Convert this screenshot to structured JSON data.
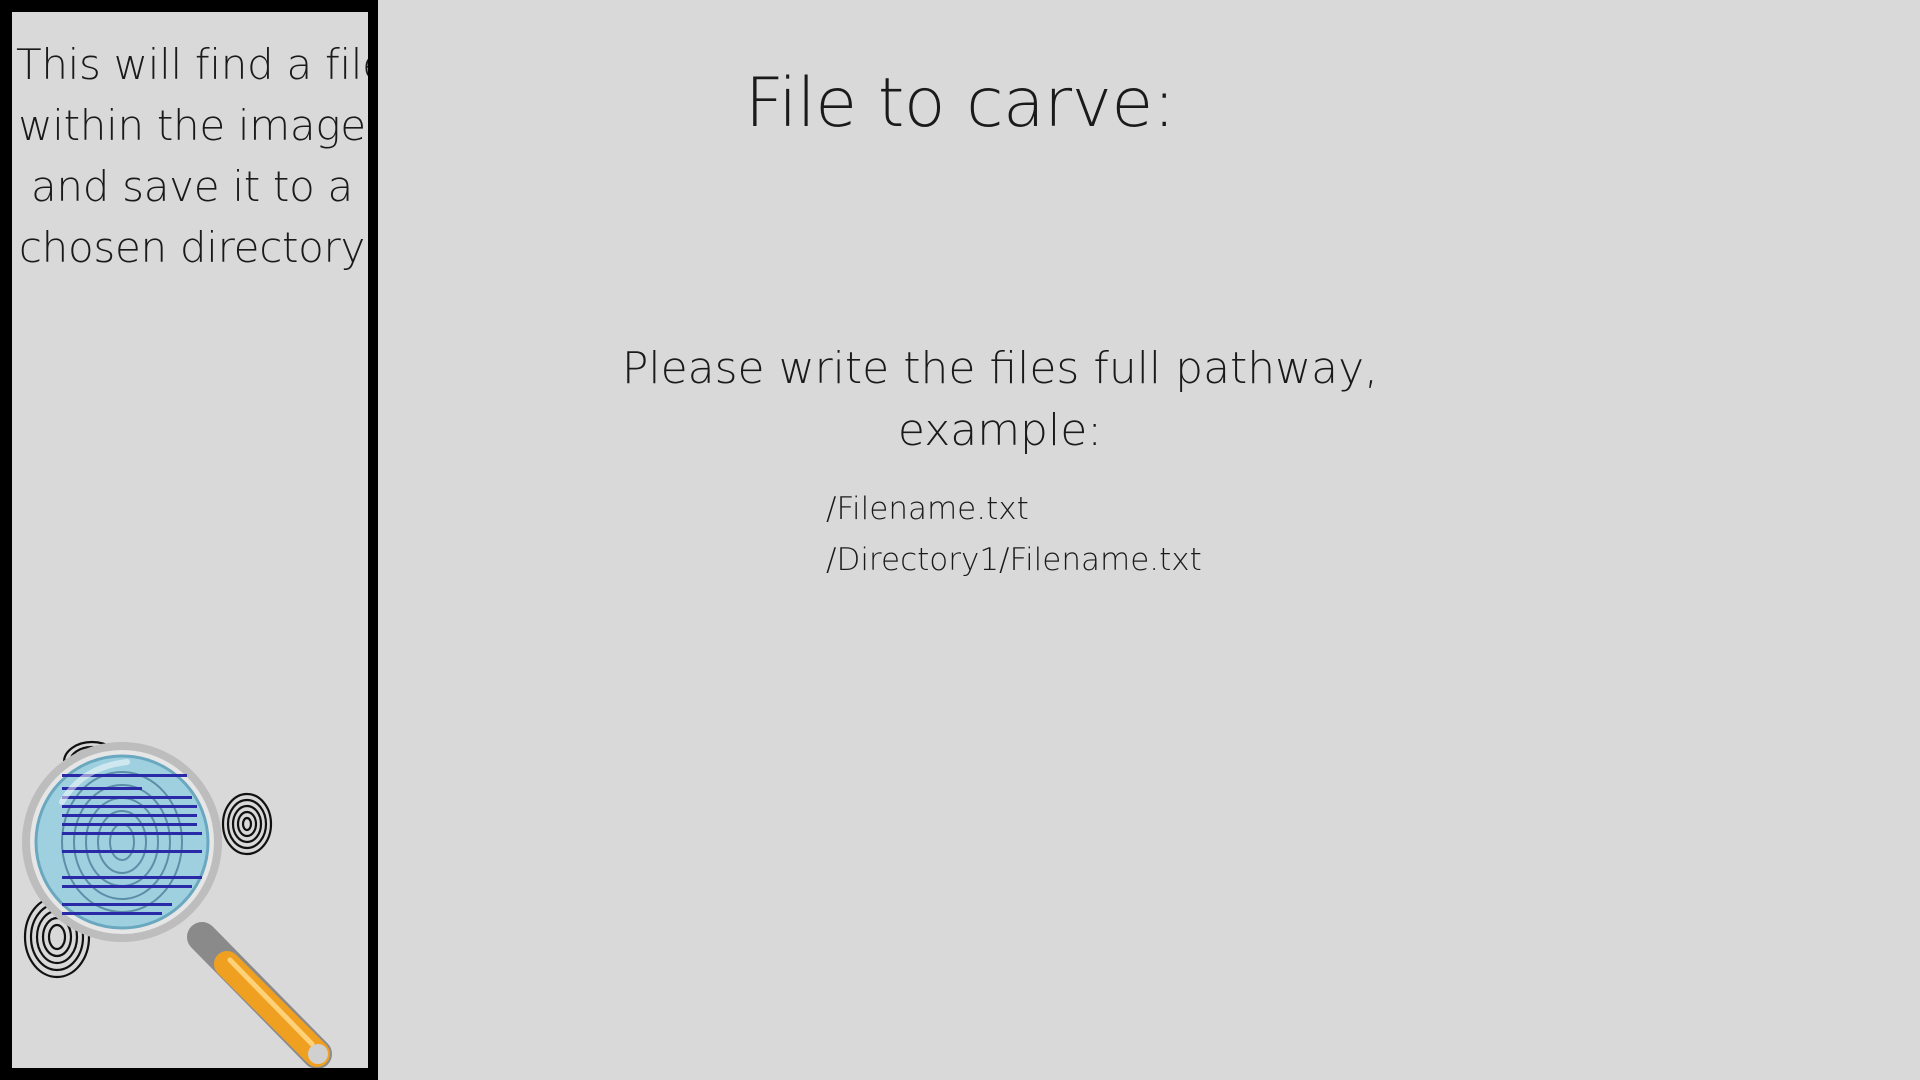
{
  "sidebar": {
    "description_lines": [
      "This will find a file",
      "within the image",
      "and save it to a",
      "chosen directory"
    ],
    "logo_icon": "magnifier-fingerprint-icon"
  },
  "main": {
    "title": "File to carve:",
    "instruction_lines": [
      "Please write the files full pathway,",
      "example:"
    ],
    "examples": [
      "/Filename.txt",
      "/Directory1/Filename.txt"
    ]
  },
  "colors": {
    "background": "#d9d9d9",
    "frame": "#000000",
    "text": "#1a1a1a",
    "handle": "#f0a020",
    "lens": "#9fd0e0"
  }
}
